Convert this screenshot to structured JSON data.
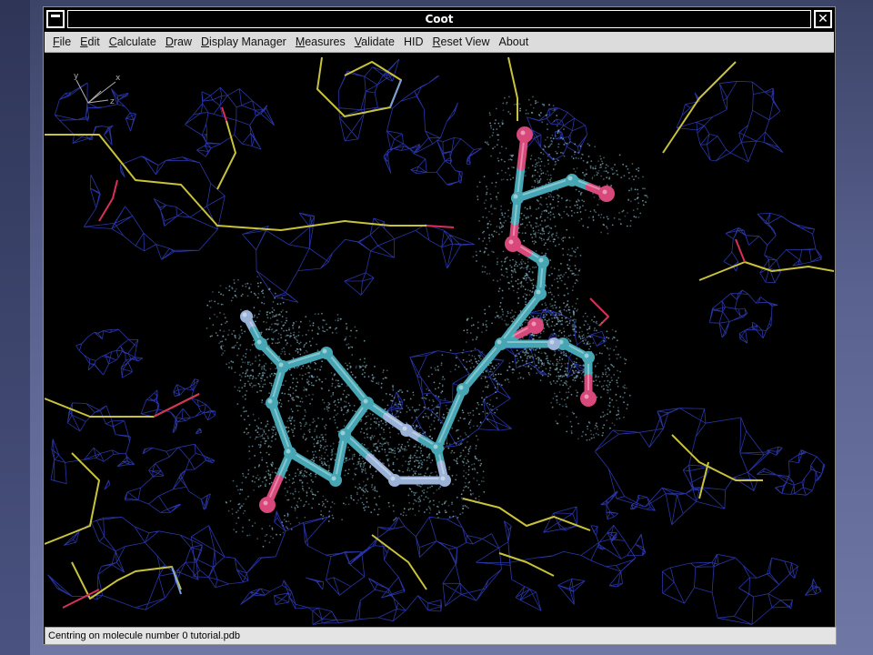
{
  "window": {
    "title": "Coot",
    "close_glyph": "✕"
  },
  "menu": [
    {
      "label": "File",
      "u": "F",
      "rest": "ile"
    },
    {
      "label": "Edit",
      "u": "E",
      "rest": "dit"
    },
    {
      "label": "Calculate",
      "u": "C",
      "rest": "alculate"
    },
    {
      "label": "Draw",
      "u": "D",
      "rest": "raw"
    },
    {
      "label": "Display Manager",
      "u": "D",
      "rest": "isplay Manager"
    },
    {
      "label": "Measures",
      "u": "M",
      "rest": "easures"
    },
    {
      "label": "Validate",
      "u": "V",
      "rest": "alidate"
    },
    {
      "label": "HID",
      "u": "",
      "rest": "HID"
    },
    {
      "label": "Reset View",
      "u": "R",
      "rest": "eset View"
    },
    {
      "label": "About",
      "u": "",
      "rest": "About"
    }
  ],
  "viewport": {
    "axes_labels": {
      "y": "y",
      "x": "x",
      "z": "z"
    },
    "colors": {
      "density_mesh": "#2d3bb8",
      "bonds_carbon": "#c9c23a",
      "bonds_oxygen": "#d8305a",
      "bonds_nitrogen": "#7aa0e0",
      "ligand_carbon": "#46a6b4",
      "ligand_nitrogen": "#9ab2d8",
      "ligand_oxygen": "#d8487a",
      "dots": "#7fb0c0"
    }
  },
  "status": {
    "text": "Centring on molecule number 0 tutorial.pdb"
  }
}
